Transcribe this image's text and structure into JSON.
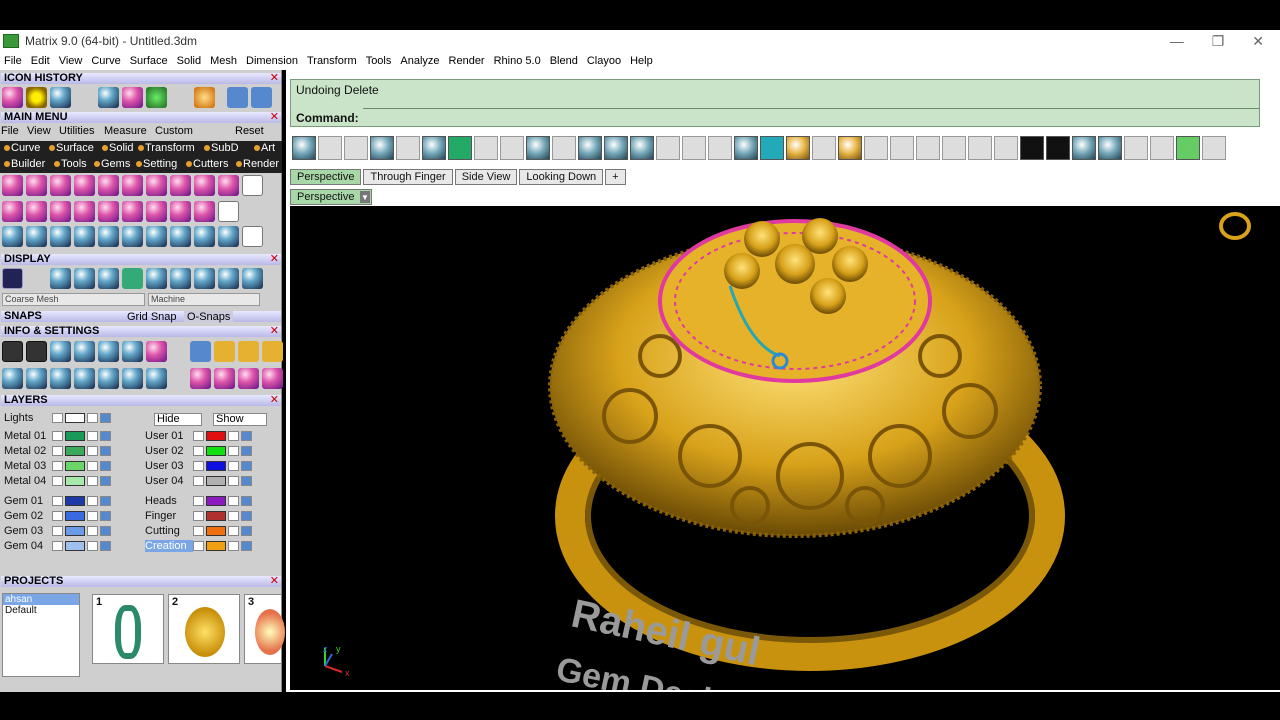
{
  "window": {
    "title": "Matrix 9.0 (64-bit) - Untitled.3dm",
    "min": "—",
    "restore": "❐",
    "close": "✕"
  },
  "menubar": [
    "File",
    "Edit",
    "View",
    "Curve",
    "Surface",
    "Solid",
    "Mesh",
    "Dimension",
    "Transform",
    "Tools",
    "Analyze",
    "Render",
    "Rhino 5.0",
    "Blend",
    "Clayoo",
    "Help"
  ],
  "panels": {
    "icon_history": "ICON HISTORY",
    "main_menu": "MAIN MENU",
    "main_menu_items": [
      "File",
      "View",
      "Utilities",
      "Measure",
      "Custom",
      "Reset"
    ],
    "categories_row1": [
      "Curve",
      "Surface",
      "Solid",
      "Transform",
      "SubD",
      "Art"
    ],
    "categories_row2": [
      "Builder",
      "Tools",
      "Gems",
      "Setting",
      "Cutters",
      "Render"
    ],
    "display": "DISPLAY",
    "display_mesh": "Coarse Mesh",
    "display_mode": "Machine",
    "snaps": "SNAPS",
    "grid_snap": "Grid Snap",
    "osnaps": "O-Snaps",
    "info_settings": "INFO & SETTINGS",
    "layers": "LAYERS",
    "lights": "Lights",
    "hide": "Hide",
    "show": "Show",
    "projects": "PROJECTS",
    "close_x": "✕"
  },
  "layers": {
    "left": [
      {
        "name": "Metal 01",
        "color": "#1a9a5a"
      },
      {
        "name": "Metal 02",
        "color": "#3aaa5a"
      },
      {
        "name": "Metal 03",
        "color": "#6ad66a"
      },
      {
        "name": "Metal 04",
        "color": "#a8e8a8"
      },
      {
        "name": "Gem 01",
        "color": "#1a3aa8"
      },
      {
        "name": "Gem 02",
        "color": "#3a6ae0"
      },
      {
        "name": "Gem 03",
        "color": "#6a9ae8"
      },
      {
        "name": "Gem 04",
        "color": "#a0c0f0"
      }
    ],
    "right": [
      {
        "name": "User 01",
        "color": "#e01010"
      },
      {
        "name": "User 02",
        "color": "#10e010"
      },
      {
        "name": "User 03",
        "color": "#1010e0"
      },
      {
        "name": "User 04",
        "color": "#b0b0b0"
      },
      {
        "name": "Heads",
        "color": "#8a1ac0"
      },
      {
        "name": "Finger",
        "color": "#b03030"
      },
      {
        "name": "Cutting",
        "color": "#f07010"
      },
      {
        "name": "Creation",
        "color": "#f0a010"
      }
    ]
  },
  "projects": {
    "list": [
      "ahsan",
      "Default"
    ],
    "thumbs": [
      "1",
      "2",
      "3"
    ]
  },
  "command": {
    "history": "Undoing Delete",
    "label": "Command:"
  },
  "tabs": [
    "Perspective",
    "Through Finger",
    "Side View",
    "Looking Down",
    "+"
  ],
  "viewport": {
    "label": "Perspective",
    "watermark1": "Raheil gul",
    "watermark2": "Gem Desi",
    "axis_x": "x",
    "axis_y": "y",
    "axis_z": "z"
  },
  "colors": {
    "gold": "#d8a21a",
    "gold_dark": "#7a5808",
    "pink": "#e03aa0",
    "command_bg": "#c9e4c9"
  }
}
